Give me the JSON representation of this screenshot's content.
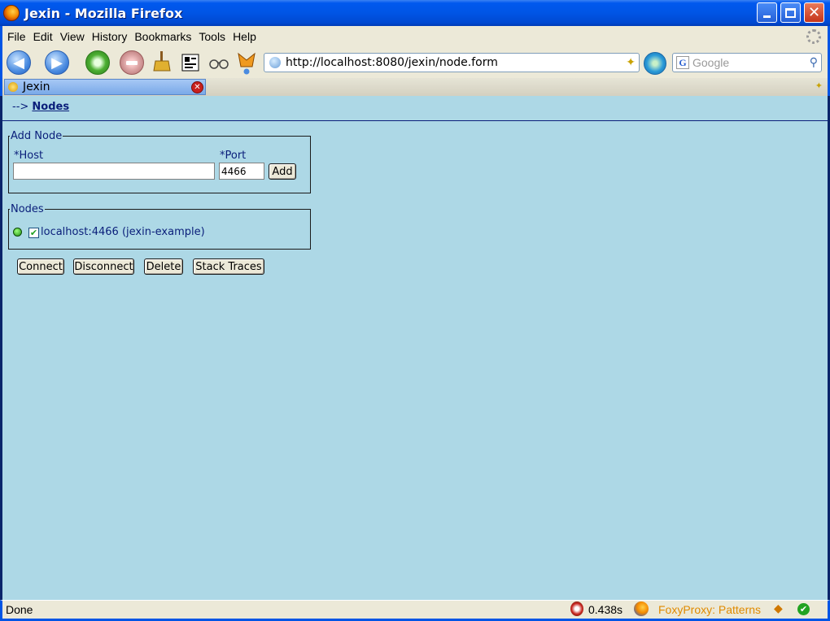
{
  "window": {
    "title": "Jexin - Mozilla Firefox"
  },
  "menu": {
    "items": [
      "File",
      "Edit",
      "View",
      "History",
      "Bookmarks",
      "Tools",
      "Help"
    ]
  },
  "toolbar": {
    "url": "http://localhost:8080/jexin/node.form",
    "search_placeholder": "Google",
    "search_engine_letter": "G"
  },
  "tab": {
    "label": "Jexin"
  },
  "page": {
    "breadcrumb_prefix": "-->",
    "breadcrumb_link": "Nodes",
    "add_node": {
      "legend": "Add Node",
      "host_label": "*Host",
      "host_value": "",
      "port_label": "*Port",
      "port_value": "4466",
      "add_button": "Add"
    },
    "nodes": {
      "legend": "Nodes",
      "items": [
        {
          "label": "localhost:4466 (jexin-example)",
          "checked": true,
          "status": "connected"
        }
      ]
    },
    "actions": {
      "connect": "Connect",
      "disconnect": "Disconnect",
      "delete": "Delete",
      "stack_traces": "Stack Traces"
    }
  },
  "status": {
    "text": "Done",
    "timer": "0.438s",
    "proxy": "FoxyProxy: Patterns"
  },
  "colors": {
    "content_bg": "#add8e6",
    "link": "#0a1e7a",
    "xp_blue": "#0055e5"
  }
}
